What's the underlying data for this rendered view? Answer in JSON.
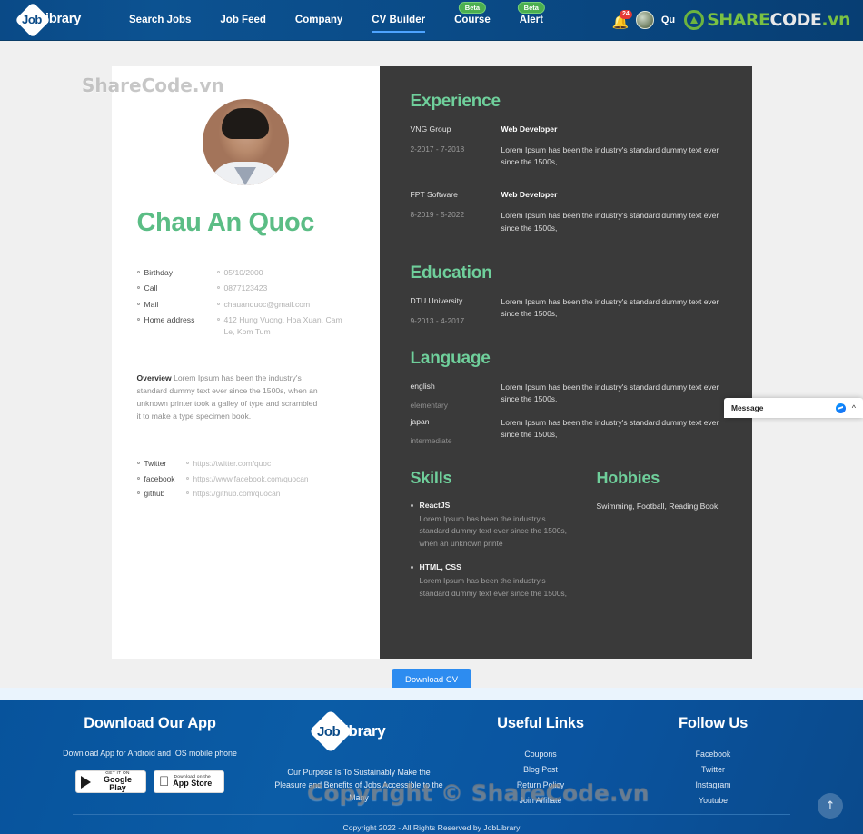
{
  "navbar": {
    "logo_prefix": "Job",
    "logo_suffix": "ibrary",
    "links": [
      {
        "label": "Search Jobs",
        "badge": null,
        "active": false
      },
      {
        "label": "Job Feed",
        "badge": null,
        "active": false
      },
      {
        "label": "Company",
        "badge": null,
        "active": false
      },
      {
        "label": "CV Builder",
        "badge": null,
        "active": true
      },
      {
        "label": "Course",
        "badge": "Beta",
        "active": false
      },
      {
        "label": "Alert",
        "badge": "Beta",
        "active": false
      }
    ],
    "notification_count": "24",
    "user_name": "Qu",
    "sharecode": {
      "share": "SHARE",
      "code": "CODE",
      "vn": ".vn"
    }
  },
  "watermarks": {
    "top": "ShareCode.vn",
    "bottom": "Copyright © ShareCode.vn"
  },
  "cv": {
    "name": "Chau An Quoc",
    "info": [
      {
        "key": "Birthday",
        "value": "05/10/2000"
      },
      {
        "key": "Call",
        "value": "0877123423"
      },
      {
        "key": "Mail",
        "value": "chauanquoc@gmail.com"
      },
      {
        "key": "Home address",
        "value": "412 Hung Vuong, Hoa Xuan, Cam Le, Kom Tum"
      }
    ],
    "overview_label": "Overview",
    "overview_text": " Lorem Ipsum has been the industry's standard dummy text ever since the 1500s, when an unknown printer took a galley of type and scrambled it to make a type specimen book.",
    "links": [
      {
        "key": "Twitter",
        "value": "https://twitter.com/quoc"
      },
      {
        "key": "facebook",
        "value": "https://www.facebook.com/quocan"
      },
      {
        "key": "github",
        "value": "https://github.com/quocan"
      }
    ],
    "experience": {
      "title": "Experience",
      "items": [
        {
          "org": "VNG Group",
          "date": "2-2017 - 7-2018",
          "role": "Web Developer",
          "desc": "Lorem Ipsum has been the industry's standard dummy text ever since the 1500s,"
        },
        {
          "org": "FPT Software",
          "date": "8-2019 - 5-2022",
          "role": "Web Developer",
          "desc": "Lorem Ipsum has been the industry's standard dummy text ever since the 1500s,"
        }
      ]
    },
    "education": {
      "title": "Education",
      "items": [
        {
          "org": "DTU University",
          "date": "9-2013 - 4-2017",
          "role": "",
          "desc": "Lorem Ipsum has been the industry's standard dummy text ever since the 1500s,"
        }
      ]
    },
    "language": {
      "title": "Language",
      "items": [
        {
          "name": "english",
          "level": "elementary",
          "desc": "Lorem Ipsum has been the industry's standard dummy text ever since the 1500s,"
        },
        {
          "name": "japan",
          "level": "intermediate",
          "desc": "Lorem Ipsum has been the industry's standard dummy text ever since the 1500s,"
        }
      ]
    },
    "skills": {
      "title": "Skills",
      "items": [
        {
          "name": "ReactJS",
          "desc": "Lorem Ipsum has been the industry's standard dummy text ever since the 1500s, when an unknown printe"
        },
        {
          "name": "HTML, CSS",
          "desc": "Lorem Ipsum has been the industry's standard dummy text ever since the 1500s,"
        }
      ]
    },
    "hobbies": {
      "title": "Hobbies",
      "text": "Swimming, Football, Reading Book"
    }
  },
  "download_button": "Download CV",
  "message_widget": {
    "label": "Message"
  },
  "footer": {
    "app": {
      "title": "Download Our App",
      "subtitle": "Download App for Android and IOS mobile phone",
      "google_play_small": "GET IT ON",
      "google_play_big": "Google Play",
      "app_store_small": "Download on the",
      "app_store_big": "App Store"
    },
    "brand": {
      "logo_prefix": "Job",
      "logo_suffix": "ibrary",
      "purpose": "Our Purpose Is To Sustainably Make the Pleasure and Benefits of Jobs Accessible to the Many"
    },
    "useful_links": {
      "title": "Useful Links",
      "items": [
        "Coupons",
        "Blog Post",
        "Return Policy",
        "Join Affiliate"
      ]
    },
    "follow_us": {
      "title": "Follow Us",
      "items": [
        "Facebook",
        "Twitter",
        "Instagram",
        "Youtube"
      ]
    },
    "copyright": "Copyright 2022 - All Rights Reserved by JobLibrary"
  },
  "colors": {
    "nav_blue": "#0a4a87",
    "accent_green": "#6fcf9b",
    "name_green": "#5bbd85",
    "cv_dark": "#3a3a3a",
    "button_blue": "#2d8cf0",
    "badge_red": "#e53935",
    "beta_green": "#4caf50"
  }
}
